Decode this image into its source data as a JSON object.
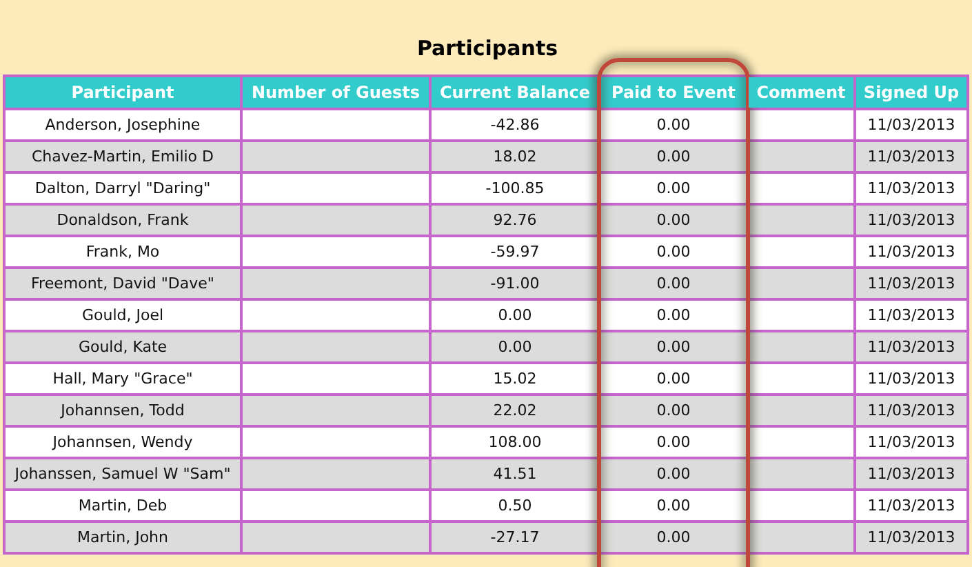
{
  "title": "Participants",
  "columns": [
    {
      "label": "Participant",
      "highlighted": false
    },
    {
      "label": "Number of Guests",
      "highlighted": false
    },
    {
      "label": "Current Balance",
      "highlighted": false
    },
    {
      "label": "Paid to Event",
      "highlighted": true
    },
    {
      "label": "Comment",
      "highlighted": false
    },
    {
      "label": "Signed Up",
      "highlighted": false
    }
  ],
  "rows": [
    [
      "Anderson, Josephine",
      "",
      "-42.86",
      "0.00",
      "",
      "11/03/2013"
    ],
    [
      "Chavez-Martin, Emilio D",
      "",
      "18.02",
      "0.00",
      "",
      "11/03/2013"
    ],
    [
      "Dalton, Darryl \"Daring\"",
      "",
      "-100.85",
      "0.00",
      "",
      "11/03/2013"
    ],
    [
      "Donaldson, Frank",
      "",
      "92.76",
      "0.00",
      "",
      "11/03/2013"
    ],
    [
      "Frank, Mo",
      "",
      "-59.97",
      "0.00",
      "",
      "11/03/2013"
    ],
    [
      "Freemont, David \"Dave\"",
      "",
      "-91.00",
      "0.00",
      "",
      "11/03/2013"
    ],
    [
      "Gould, Joel",
      "",
      "0.00",
      "0.00",
      "",
      "11/03/2013"
    ],
    [
      "Gould, Kate",
      "",
      "0.00",
      "0.00",
      "",
      "11/03/2013"
    ],
    [
      "Hall, Mary \"Grace\"",
      "",
      "15.02",
      "0.00",
      "",
      "11/03/2013"
    ],
    [
      "Johannsen, Todd",
      "",
      "22.02",
      "0.00",
      "",
      "11/03/2013"
    ],
    [
      "Johannsen, Wendy",
      "",
      "108.00",
      "0.00",
      "",
      "11/03/2013"
    ],
    [
      "Johanssen, Samuel W \"Sam\"",
      "",
      "41.51",
      "0.00",
      "",
      "11/03/2013"
    ],
    [
      "Martin, Deb",
      "",
      "0.50",
      "0.00",
      "",
      "11/03/2013"
    ],
    [
      "Martin, John",
      "",
      "-27.17",
      "0.00",
      "",
      "11/03/2013"
    ]
  ]
}
